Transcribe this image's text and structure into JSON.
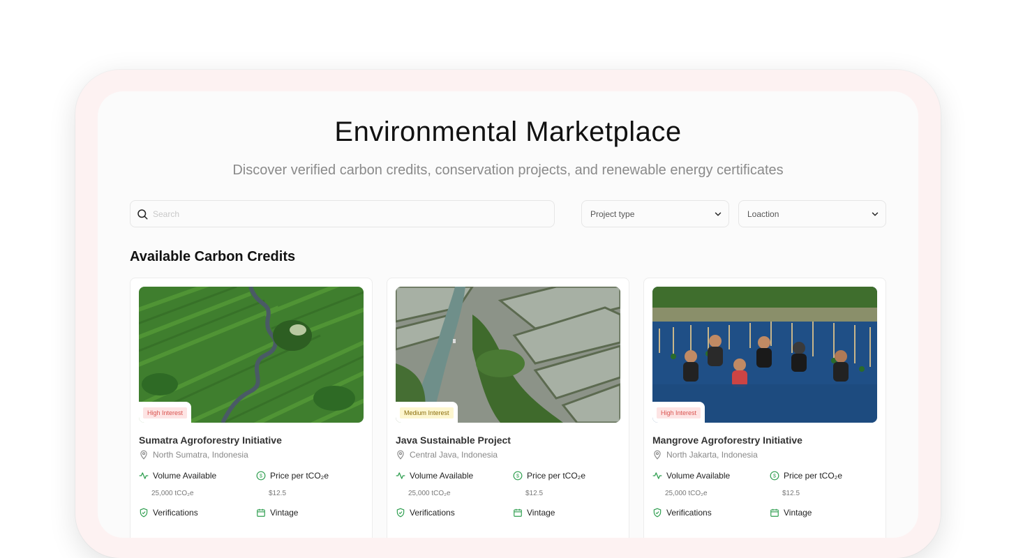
{
  "page": {
    "title": "Environmental Marketplace",
    "subtitle": "Discover verified carbon credits, conservation projects, and renewable energy certificates"
  },
  "filters": {
    "search_placeholder": "Search",
    "project_type_label": "Project type",
    "location_label": "Loaction"
  },
  "section": {
    "title": "Available Carbon Credits"
  },
  "colors": {
    "accent_green": "#2e9e4f",
    "badge_high_bg": "#fde4e4",
    "badge_medium_bg": "#fdf6cf",
    "device_frame": "#fdf2f2"
  },
  "icons": [
    "search-icon",
    "chevron-down-icon",
    "map-pin-icon",
    "activity-icon",
    "dollar-circle-icon",
    "shield-check-icon",
    "calendar-icon"
  ],
  "cards": [
    {
      "badge": "High Interest",
      "badge_level": "high",
      "name": "Sumatra Agroforestry Initiative",
      "location": "North Sumatra, Indonesia",
      "volume_label": "Volume Available",
      "volume_value": "25,000 tCO₂e",
      "price_label": "Price per tCO₂e",
      "price_value": "$12.5",
      "verifications_label": "Verifications",
      "vintage_label": "Vintage",
      "image": "aerial-forest-river"
    },
    {
      "badge": "Medium Interest",
      "badge_level": "medium",
      "name": "Java Sustainable Project",
      "location": "Central Java, Indonesia",
      "volume_label": "Volume Available",
      "volume_value": "25,000 tCO₂e",
      "price_label": "Price per tCO₂e",
      "price_value": "$12.5",
      "verifications_label": "Verifications",
      "vintage_label": "Vintage",
      "image": "aerial-ponds-river"
    },
    {
      "badge": "High Interest",
      "badge_level": "high",
      "name": "Mangrove Agroforestry Initiative",
      "location": "North Jakarta, Indonesia",
      "volume_label": "Volume Available",
      "volume_value": "25,000 tCO₂e",
      "price_label": "Price per tCO₂e",
      "price_value": "$12.5",
      "verifications_label": "Verifications",
      "vintage_label": "Vintage",
      "image": "mangrove-planting-group"
    }
  ]
}
